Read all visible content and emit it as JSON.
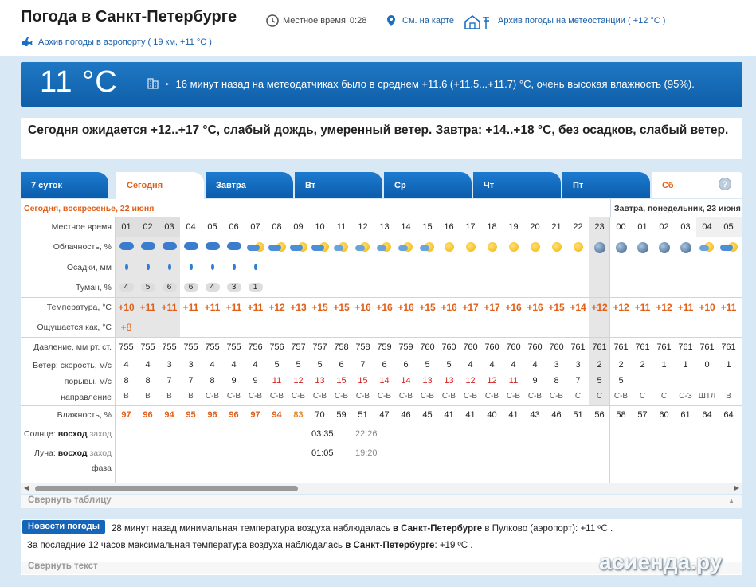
{
  "header": {
    "title": "Погода в Санкт-Петербурге",
    "local_time_label": "Местное время",
    "local_time": "0:28",
    "map_link": "См. на карте",
    "archive_station": "Архив погоды на метеостанции ( +12 °C )",
    "archive_airport": "Архив погоды в аэропорту ( 19 км, +11 °C )"
  },
  "banner": {
    "temp": "11 °C",
    "sensor_text": "16 минут назад на метеодатчиках было в среднем +11.6 (+11.5...+11.7) °C, очень высокая влажность (95%)."
  },
  "forecast_text": "Сегодня ожидается +12..+17 °C, слабый дождь, умеренный ветер. Завтра: +14..+18 °C, без осадков, слабый ветер.",
  "tabs": [
    {
      "label": "7 суток"
    },
    {
      "label": "Сегодня"
    },
    {
      "label": "Завтра"
    },
    {
      "label": "Вт"
    },
    {
      "label": "Ср"
    },
    {
      "label": "Чт"
    },
    {
      "label": "Пт"
    },
    {
      "label": "Сб"
    }
  ],
  "help_label": "?",
  "day_today": "Сегодня, воскресенье, 22 июня",
  "day_tomorrow": "Завтра, понедельник, 23 июня",
  "row_labels": {
    "time": "Местное время",
    "cloud": "Облачность, %",
    "precip": "Осадки, мм",
    "fog": "Туман, %",
    "temp": "Температура, °C",
    "feels": "Ощущается как, °C",
    "pressure": "Давление, мм рт. ст.",
    "wind_speed": "Ветер: скорость, м/с",
    "gusts": "порывы, м/с",
    "direction": "направление",
    "humidity": "Влажность, %",
    "sun_prefix": "Солнце:",
    "sunrise_label": "восход",
    "sunset_label": "заход",
    "moon_prefix": "Луна:",
    "moonrise_label": "восход",
    "moonset_label": "заход",
    "phase": "фаза"
  },
  "hours": [
    "01",
    "02",
    "03",
    "04",
    "05",
    "06",
    "07",
    "08",
    "09",
    "10",
    "11",
    "12",
    "13",
    "14",
    "15",
    "16",
    "17",
    "18",
    "19",
    "20",
    "21",
    "22",
    "23",
    "00",
    "01",
    "02",
    "03",
    "04",
    "05"
  ],
  "cloud_icons": [
    "rain-cloud",
    "rain-cloud",
    "rain-cloud",
    "rain-cloud",
    "rain-cloud",
    "rain-cloud",
    "partly-cloudy",
    "partly-cloudy",
    "partly-cloudy",
    "partly-cloudy",
    "sun-cloud",
    "sun-cloud",
    "sun-cloud",
    "sun-cloud",
    "sun-cloud",
    "sun",
    "sun",
    "sun",
    "sun",
    "sun",
    "sun",
    "sun",
    "night",
    "night",
    "night",
    "night",
    "night",
    "sun-cloud",
    "partly-cloudy"
  ],
  "precip_icons": [
    true,
    true,
    true,
    true,
    true,
    true,
    true,
    false,
    false,
    false,
    false,
    false,
    false,
    false,
    false,
    false,
    false,
    false,
    false,
    false,
    false,
    false,
    false,
    false,
    false,
    false,
    false,
    false,
    false
  ],
  "fog": [
    "4",
    "5",
    "6",
    "6",
    "4",
    "3",
    "1",
    "",
    "",
    "",
    "",
    "",
    "",
    "",
    "",
    "",
    "",
    "",
    "",
    "",
    "",
    "",
    "",
    "",
    "",
    "",
    "",
    "",
    ""
  ],
  "temp": [
    "+10",
    "+11",
    "+11",
    "+11",
    "+11",
    "+11",
    "+11",
    "+12",
    "+13",
    "+15",
    "+15",
    "+16",
    "+16",
    "+16",
    "+15",
    "+16",
    "+17",
    "+17",
    "+16",
    "+16",
    "+15",
    "+14",
    "+12",
    "+12",
    "+11",
    "+12",
    "+11",
    "+10",
    "+11"
  ],
  "feels": [
    "+8"
  ],
  "pressure": [
    "755",
    "755",
    "755",
    "755",
    "755",
    "755",
    "756",
    "756",
    "757",
    "757",
    "758",
    "758",
    "759",
    "759",
    "760",
    "760",
    "760",
    "760",
    "760",
    "760",
    "760",
    "761",
    "761",
    "761",
    "761",
    "761",
    "761",
    "761",
    "761"
  ],
  "wind": [
    "4",
    "4",
    "3",
    "3",
    "4",
    "4",
    "4",
    "5",
    "5",
    "5",
    "6",
    "7",
    "6",
    "6",
    "5",
    "5",
    "4",
    "4",
    "4",
    "4",
    "3",
    "3",
    "2",
    "2",
    "2",
    "1",
    "1",
    "0",
    "1"
  ],
  "gusts": [
    "8",
    "8",
    "7",
    "7",
    "8",
    "9",
    "9",
    "11",
    "12",
    "13",
    "15",
    "15",
    "14",
    "14",
    "13",
    "13",
    "12",
    "12",
    "11",
    "9",
    "8",
    "7",
    "5",
    "5",
    "",
    "",
    "",
    "",
    ""
  ],
  "direction": [
    "В",
    "В",
    "В",
    "В",
    "С-В",
    "С-В",
    "С-В",
    "С-В",
    "С-В",
    "С-В",
    "С-В",
    "С-В",
    "С-В",
    "С-В",
    "С-В",
    "С-В",
    "С-В",
    "С-В",
    "С-В",
    "С-В",
    "С-В",
    "С",
    "С",
    "С-В",
    "С",
    "С",
    "С-З",
    "ШТЛ",
    "В"
  ],
  "humidity": [
    "97",
    "96",
    "94",
    "95",
    "96",
    "96",
    "97",
    "94",
    "83",
    "70",
    "59",
    "51",
    "47",
    "46",
    "45",
    "41",
    "41",
    "40",
    "41",
    "43",
    "46",
    "51",
    "56",
    "58",
    "57",
    "60",
    "61",
    "64",
    "64"
  ],
  "sunrise": "03:35",
  "sunset": "22:26",
  "moonrise": "01:05",
  "moonset": "19:20",
  "collapse_table": "Свернуть таблицу",
  "news": {
    "button": "Новости погоды",
    "line1_a": "28 минут назад минимальная температура воздуха наблюдалась ",
    "line1_b": "в Санкт-Петербурге",
    "line1_c": " в Пулково (аэропорт): +11 ºC .",
    "line2_a": "За последние 12 часов максимальная температура воздуха наблюдалась ",
    "line2_b": "в Санкт-Петербурге",
    "line2_c": ": +19 ºC .",
    "collapse": "Свернуть текст"
  },
  "watermark": "асиенда.ру",
  "colors": {
    "accent": "#1566b8",
    "orange": "#e0601a",
    "red": "#d62020"
  }
}
